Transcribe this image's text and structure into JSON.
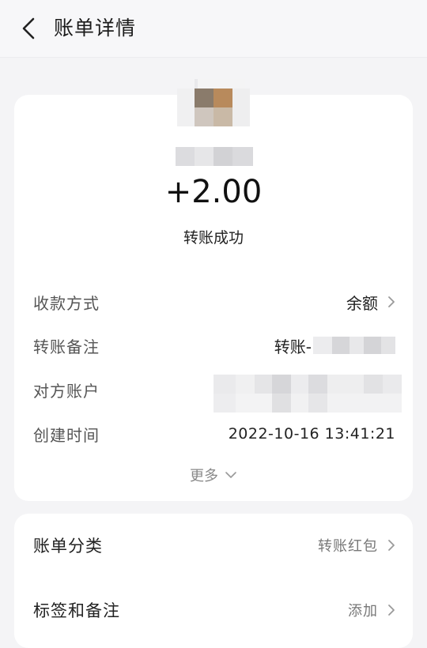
{
  "header": {
    "title": "账单详情",
    "back_icon": "chevron-left-icon"
  },
  "summary": {
    "amount": "+2.00",
    "status": "转账成功"
  },
  "details": [
    {
      "label": "收款方式",
      "value": "余额"
    },
    {
      "label": "转账备注",
      "value": "转账-"
    },
    {
      "label": "对方账户",
      "value": ""
    },
    {
      "label": "创建时间",
      "value": "2022-10-16 13:41:21"
    }
  ],
  "more_label": "更多",
  "extra": [
    {
      "label": "账单分类",
      "value": "转账红包"
    },
    {
      "label": "标签和备注",
      "value": "添加"
    }
  ]
}
